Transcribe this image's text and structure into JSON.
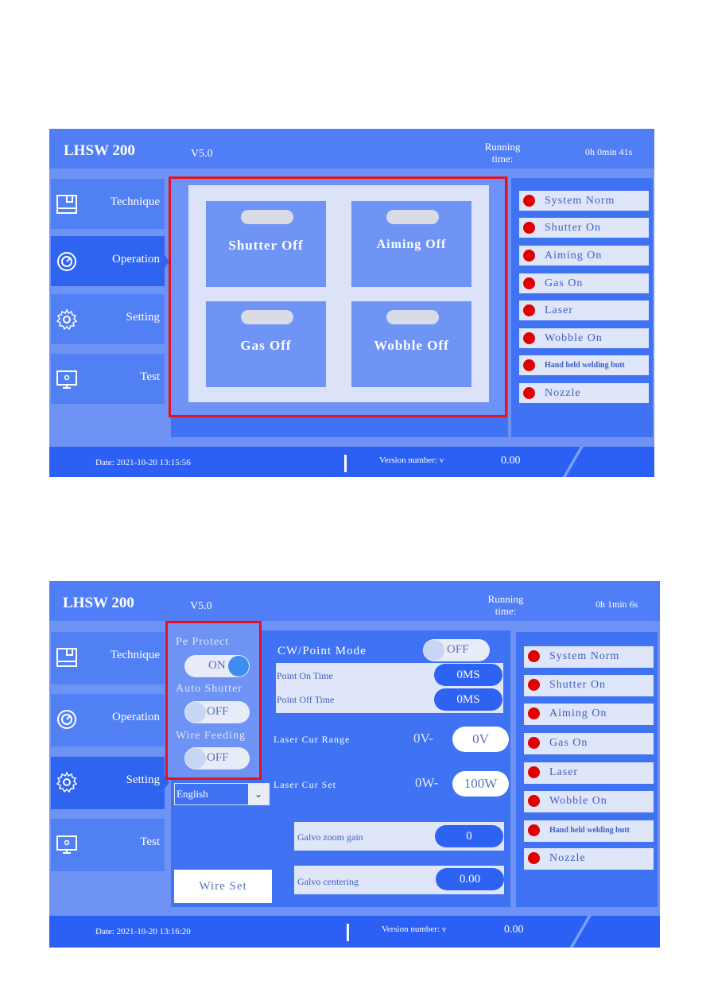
{
  "screen1": {
    "header": {
      "title": "LHSW 200",
      "version": "V5.0",
      "running_label_1": "Running",
      "running_label_2": "time:",
      "running_value": "0h 0min 41s"
    },
    "nav": [
      {
        "label": "Technique",
        "icon": "book-icon"
      },
      {
        "label": "Operation",
        "icon": "gauge-icon",
        "active": true
      },
      {
        "label": "Setting",
        "icon": "gear-icon"
      },
      {
        "label": "Test",
        "icon": "monitor-icon"
      }
    ],
    "operation_buttons": [
      {
        "label": "Shutter Off"
      },
      {
        "label": "Aiming Off"
      },
      {
        "label": "Gas Off"
      },
      {
        "label": "Wobble Off"
      }
    ],
    "status_list": [
      "System Norm",
      "Shutter On",
      "Aiming On",
      "Gas On",
      "Laser",
      "Wobble On",
      "Hand held welding butt",
      "Nozzle"
    ],
    "footer": {
      "date": "Date:  2021-10-20 13:15:56",
      "version_label": "Version number: v",
      "version_value": "0.00"
    }
  },
  "screen2": {
    "header": {
      "title": "LHSW 200",
      "version": "V5.0",
      "running_label_1": "Running",
      "running_label_2": "time:",
      "running_value": "0h 1min 6s"
    },
    "nav": [
      {
        "label": "Technique",
        "icon": "book-icon"
      },
      {
        "label": "Operation",
        "icon": "gauge-icon"
      },
      {
        "label": "Setting",
        "icon": "gear-icon",
        "active": true
      },
      {
        "label": "Test",
        "icon": "monitor-icon"
      }
    ],
    "toggles": [
      {
        "label": "Pe Protect",
        "state": "ON"
      },
      {
        "label": "Auto Shutter",
        "state": "OFF"
      },
      {
        "label": "Wire Feeding",
        "state": "OFF"
      }
    ],
    "language": {
      "selected": "English"
    },
    "wire_set_label": "Wire Set",
    "cw_point_mode": {
      "label": "CW/Point Mode",
      "state": "OFF"
    },
    "point_on_time": {
      "label": "Point On Time",
      "value": "0MS"
    },
    "point_off_time": {
      "label": "Point Off Time",
      "value": "0MS"
    },
    "laser_cur_range": {
      "label": "Laser Cur Range",
      "prefix": "0V-",
      "value": "0V"
    },
    "laser_cur_set": {
      "label": "Laser Cur Set",
      "prefix": "0W-",
      "value": "100W"
    },
    "galvo_zoom_gain": {
      "label": "Galvo zoom gain",
      "value": "0"
    },
    "galvo_centering": {
      "label": "Galvo centering",
      "value": "0.00"
    },
    "status_list": [
      "System Norm",
      "Shutter On",
      "Aiming On",
      "Gas On",
      "Laser",
      "Wobble On",
      "Hand held welding butt",
      "Nozzle"
    ],
    "footer": {
      "date": "Date:  2021-10-20 13:16:20",
      "version_label": "Version number: v",
      "version_value": "0.00"
    }
  },
  "colors": {
    "accent": "#2f64f1",
    "background": "#6e93f5",
    "led": "#e00000",
    "highlight_box": "#e8101c"
  }
}
